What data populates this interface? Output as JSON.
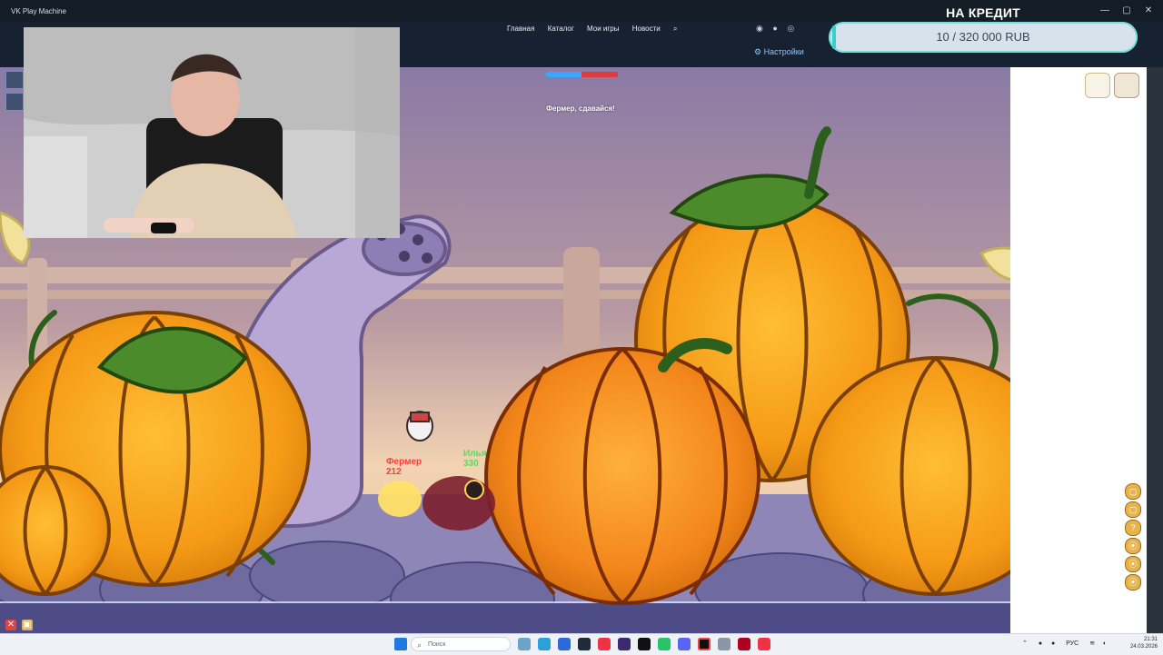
{
  "window": {
    "title": "VK Play Machine"
  },
  "nav": {
    "items": [
      "Главная",
      "Каталог",
      "Мои игры",
      "Новости"
    ]
  },
  "settings": {
    "label": "Настройки"
  },
  "credit": {
    "title": "НА КРЕДИТ",
    "amount": "10 / 320 000 RUB",
    "progress_fraction": 3e-05
  },
  "game": {
    "message": "Фермер, сдавайся!",
    "player_tags": [
      {
        "name": "Фермер",
        "value": "212"
      },
      {
        "name": "Илья",
        "value": "330"
      }
    ],
    "hp_split_fraction": 0.5
  },
  "taskbar": {
    "search_placeholder": "Поиск",
    "lang": "РУС",
    "time": "21:31",
    "date": "24.03.2026"
  },
  "icons": {
    "search": "search-icon",
    "settings": "gear-icon",
    "minimize": "minimize-icon",
    "maximize": "maximize-icon",
    "close": "close-icon"
  },
  "colors": {
    "accent": "#34d2c9",
    "link": "#8ec6ff",
    "game_sky": "#8a7aa5",
    "pumpkin": "#f59a16"
  }
}
